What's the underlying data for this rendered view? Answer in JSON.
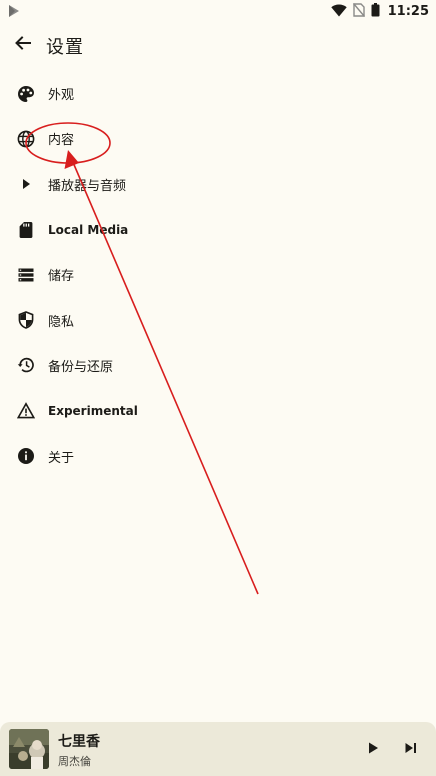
{
  "status_bar": {
    "time": "11:25",
    "app_icon": "play-store-icon",
    "wifi_icon": "wifi-icon",
    "signal_icon": "no-sim-icon",
    "battery_icon": "battery-icon"
  },
  "app_bar": {
    "back_icon": "arrow-back-icon",
    "title": "设置"
  },
  "settings": {
    "items": [
      {
        "label": "外观",
        "icon": "palette-icon"
      },
      {
        "label": "内容",
        "icon": "globe-icon"
      },
      {
        "label": "播放器与音频",
        "icon": "play-arrow-icon"
      },
      {
        "label": "Local Media",
        "icon": "sd-card-icon"
      },
      {
        "label": "储存",
        "icon": "storage-icon"
      },
      {
        "label": "隐私",
        "icon": "shield-icon"
      },
      {
        "label": "备份与还原",
        "icon": "restore-icon"
      },
      {
        "label": "Experimental",
        "icon": "warning-icon"
      },
      {
        "label": "关于",
        "icon": "info-icon"
      }
    ]
  },
  "mini_player": {
    "title": "七里香",
    "artist": "周杰倫",
    "play_icon": "play-icon",
    "next_icon": "skip-next-icon"
  },
  "annotation": {
    "color": "#d81e1e"
  },
  "colors": {
    "background": "#fdfbf3",
    "text": "#1c1b17",
    "player_background": "#ece9d9"
  }
}
